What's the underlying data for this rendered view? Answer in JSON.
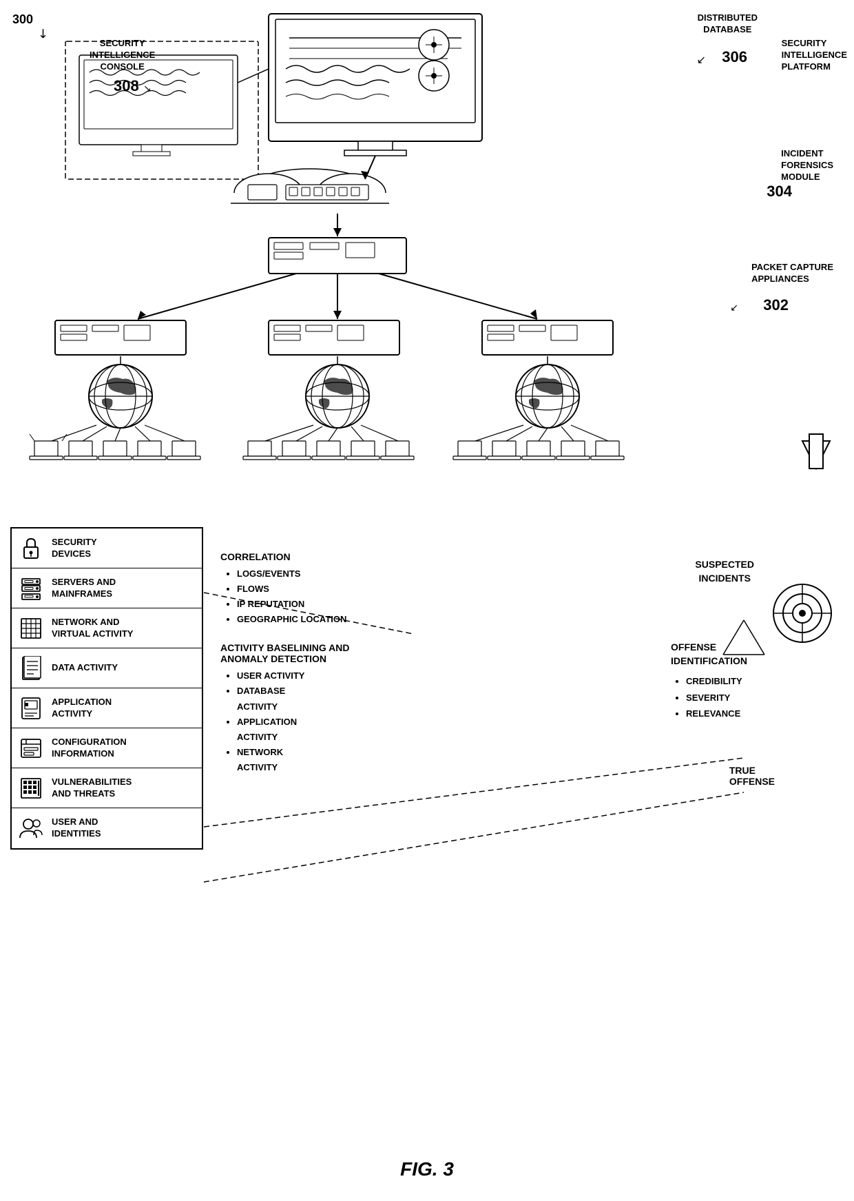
{
  "diagram": {
    "figure_number": "FIG. 3",
    "ref_300": "300",
    "labels": {
      "distributed_database": "DISTRIBUTED\nDATABASE",
      "distributed_database_num": "306",
      "security_intelligence_platform": "SECURITY\nINTELLIGENCE\nPLATFORM",
      "security_intelligence_console": "SECURITY\nINTELLIGENCE\nCONSOLE",
      "security_intelligence_console_num": "308",
      "incident_forensics_module": "INCIDENT\nFORENSICS\nMODULE",
      "incident_forensics_module_num": "304",
      "packet_capture_appliances": "PACKET CAPTURE\nAPPLIANCES",
      "packet_capture_appliances_num": "302"
    },
    "panel_items": [
      {
        "id": "security-devices",
        "label": "SECURITY\nDEVICES",
        "icon": "lock"
      },
      {
        "id": "servers-mainframes",
        "label": "SERVERS AND\nMAINFRAMES",
        "icon": "server"
      },
      {
        "id": "network-virtual",
        "label": "NETWORK AND\nVIRTUAL ACTIVITY",
        "icon": "grid"
      },
      {
        "id": "data-activity",
        "label": "DATA ACTIVITY",
        "icon": "file"
      },
      {
        "id": "application-activity",
        "label": "APPLICATION\nACTIVITY",
        "icon": "app"
      },
      {
        "id": "configuration-information",
        "label": "CONFIGURATION\nINFORMATION",
        "icon": "config"
      },
      {
        "id": "vulnerabilities-threats",
        "label": "VULNERABILITIES\nAND THREATS",
        "icon": "grid2"
      },
      {
        "id": "user-identities",
        "label": "USER AND\nIDENTITIES",
        "icon": "users"
      }
    ],
    "correlation": {
      "title": "CORRELATION",
      "items": [
        "LOGS/EVENTS",
        "FLOWS",
        "IP REPUTATION",
        "GEOGRAPHIC LOCATION"
      ]
    },
    "activity_baselining": {
      "title": "ACTIVITY BASELINING AND\nANOMALY DETECTION",
      "items": [
        "USER ACTIVITY",
        "DATABASE\nACTIVITY",
        "APPLICATION\nACTIVITY",
        "NETWORK\nACTIVITY"
      ]
    },
    "suspected_incidents": "SUSPECTED\nINCIDENTS",
    "offense_identification": {
      "title": "OFFENSE\nIDENTIFICATION",
      "items": [
        "CREDIBILITY",
        "SEVERITY",
        "RELEVANCE"
      ]
    },
    "true_offense": "TRUE\nOFFENSE"
  }
}
